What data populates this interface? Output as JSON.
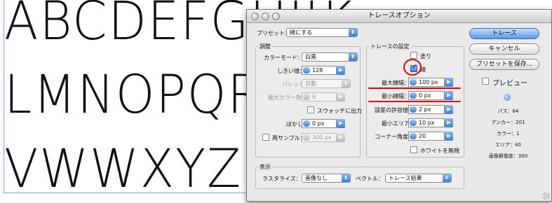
{
  "canvas": {
    "rows": [
      "ABCDEFGHIJK",
      "LMNOPQRSTUV",
      "VWWXYZ"
    ]
  },
  "dialog": {
    "title": "トレースオプション",
    "preset": {
      "label": "プリセット：",
      "value": "線にする"
    },
    "adjust": {
      "group_title": "調整",
      "color_mode": {
        "label": "カラーモード：",
        "value": "白黒"
      },
      "threshold": {
        "label": "しきい値：",
        "value": "128"
      },
      "palette": {
        "label": "パレット：",
        "value": "自動"
      },
      "max_colors": {
        "label": "最大カラー数：",
        "value": "6"
      },
      "output_swatches": {
        "label": "スウォッチに出力",
        "checked": false
      },
      "blur": {
        "label": "ぼかし：",
        "value": "0 px"
      },
      "resample": {
        "label": "再サンプル：",
        "value": "300 px",
        "checked": false
      }
    },
    "trace": {
      "group_title": "トレースの設定",
      "fill": {
        "label": "塗り",
        "checked": false
      },
      "stroke": {
        "label": "線",
        "checked": true
      },
      "max_stroke": {
        "label": "最大線幅：",
        "value": "100 px"
      },
      "min_stroke": {
        "label": "最小線幅：",
        "value": "0 px"
      },
      "path_fitting": {
        "label": "誤差の許容値：",
        "value": "2 px"
      },
      "min_area": {
        "label": "最小エリア：",
        "value": "10 px"
      },
      "corner_angle": {
        "label": "コーナー角度：",
        "value": "20"
      },
      "ignore_white": {
        "label": "ホワイトを無視",
        "checked": false
      }
    },
    "view": {
      "group_title": "表示",
      "raster": {
        "label": "ラスタライズ：",
        "value": "画像なし"
      },
      "vector": {
        "label": "ベクトル：",
        "value": "トレース結果"
      }
    },
    "buttons": {
      "trace": "トレース",
      "cancel": "キャンセル",
      "save_preset": "プリセットを保存..."
    },
    "preview": {
      "label": "プレビュー",
      "checked": false
    },
    "stats": {
      "paths": "パス：84",
      "anchors": "アンカー：201",
      "colors": "カラー：1",
      "areas": "エリア：40",
      "resolution": "画像解像度：300"
    },
    "colors": {
      "accent": "#3f7fd8",
      "annotation": "#e30000"
    }
  }
}
